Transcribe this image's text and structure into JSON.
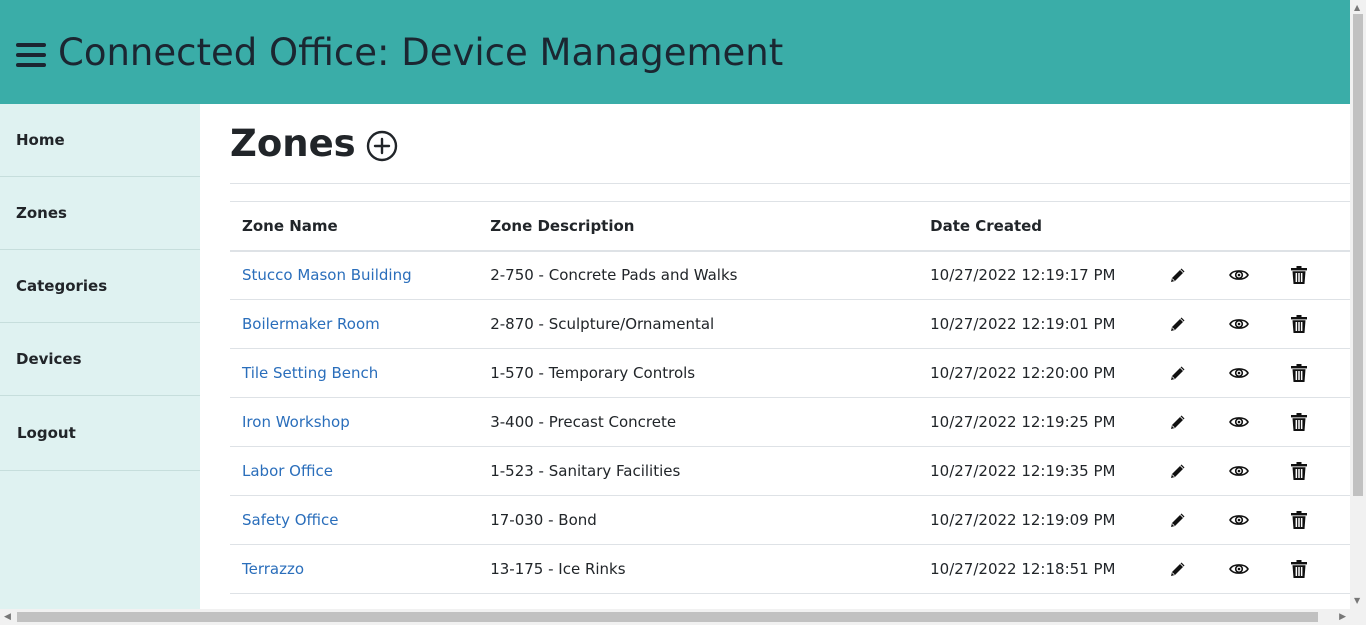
{
  "header": {
    "title": "Connected Office: Device Management"
  },
  "sidebar": {
    "items": [
      {
        "label": "Home"
      },
      {
        "label": "Zones"
      },
      {
        "label": "Categories"
      },
      {
        "label": "Devices"
      },
      {
        "label": "Logout"
      }
    ]
  },
  "page": {
    "title": "Zones"
  },
  "table": {
    "headers": {
      "name": "Zone Name",
      "description": "Zone Description",
      "date": "Date Created"
    },
    "rows": [
      {
        "name": "Stucco Mason Building",
        "description": "2-750 - Concrete Pads and Walks",
        "date": "10/27/2022 12:19:17 PM"
      },
      {
        "name": "Boilermaker Room",
        "description": "2-870 - Sculpture/Ornamental",
        "date": "10/27/2022 12:19:01 PM"
      },
      {
        "name": "Tile Setting Bench",
        "description": "1-570 - Temporary Controls",
        "date": "10/27/2022 12:20:00 PM"
      },
      {
        "name": "Iron Workshop",
        "description": "3-400 - Precast Concrete",
        "date": "10/27/2022 12:19:25 PM"
      },
      {
        "name": "Labor Office",
        "description": "1-523 - Sanitary Facilities",
        "date": "10/27/2022 12:19:35 PM"
      },
      {
        "name": "Safety Office",
        "description": "17-030 - Bond",
        "date": "10/27/2022 12:19:09 PM"
      },
      {
        "name": "Terrazzo",
        "description": "13-175 - Ice Rinks",
        "date": "10/27/2022 12:18:51 PM"
      }
    ]
  },
  "icons": {
    "menu": "hamburger-menu-icon",
    "add": "add-circle-icon",
    "edit": "pencil-icon",
    "view": "eye-icon",
    "delete": "trash-icon"
  },
  "colors": {
    "header_bg": "#3aada8",
    "sidebar_bg": "#dff2f1",
    "link": "#2a6ebb",
    "text": "#212529"
  }
}
